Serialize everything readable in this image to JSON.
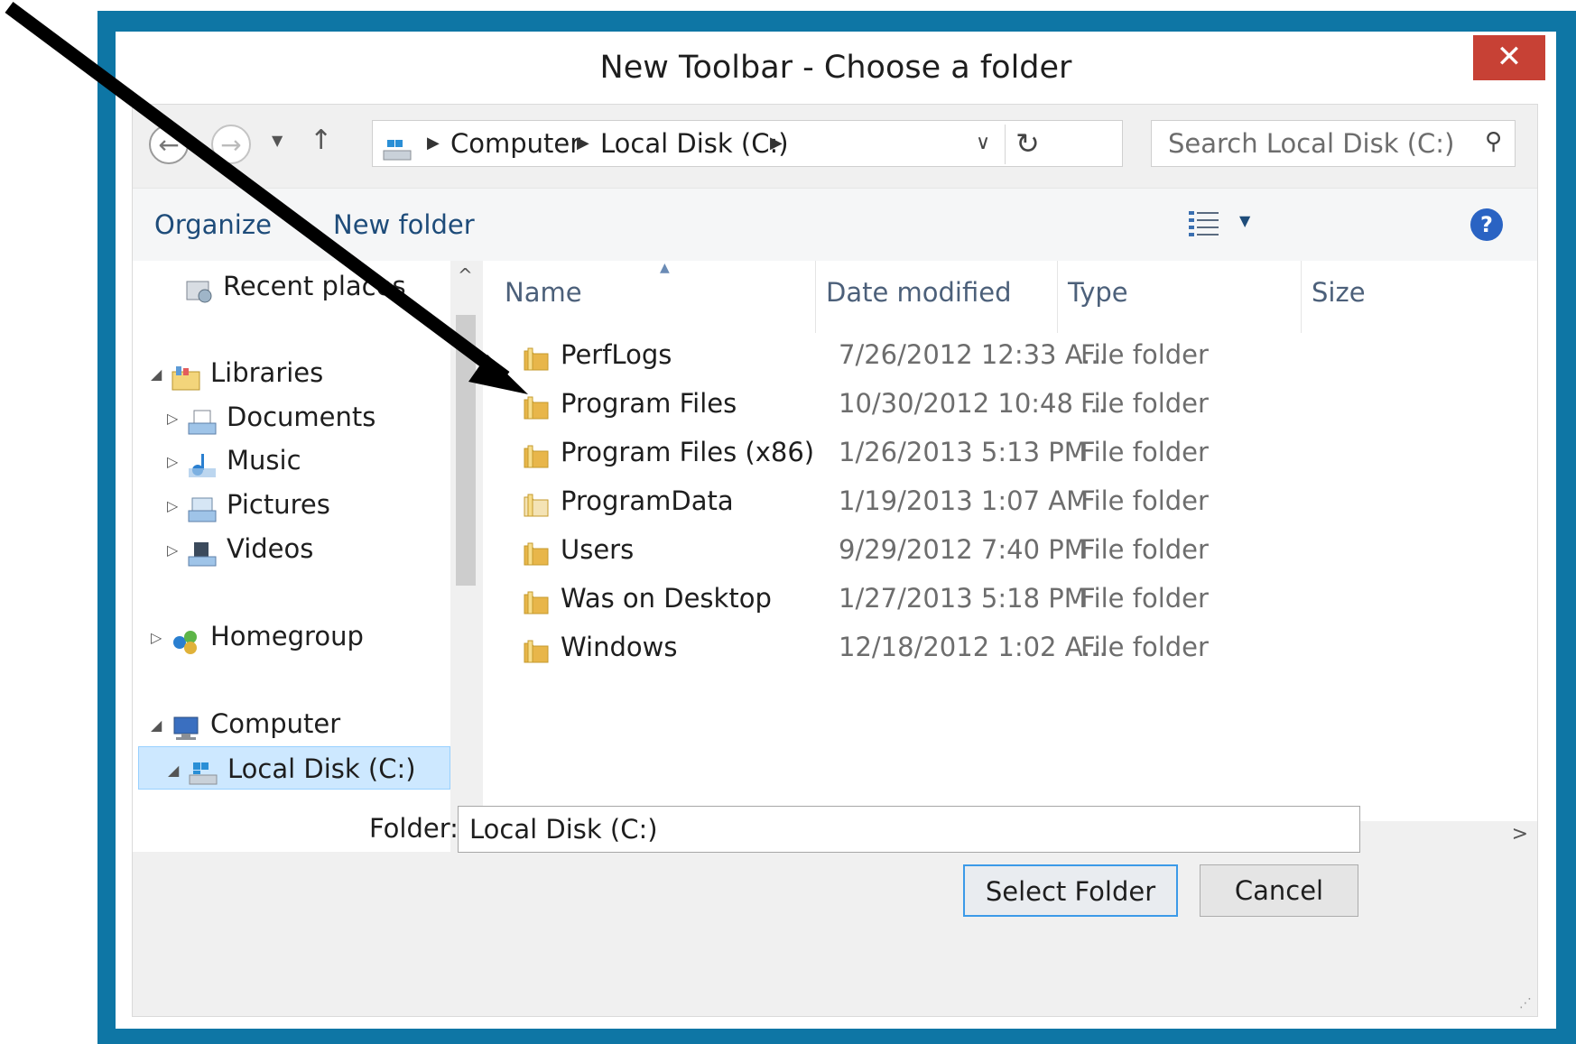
{
  "dialog": {
    "title": "New Toolbar - Choose a folder",
    "close_label": "✕"
  },
  "navbar": {
    "breadcrumb": [
      "Computer",
      "Local Disk (C:)"
    ],
    "search_placeholder": "Search Local Disk (C:)"
  },
  "commandbar": {
    "organize": "Organize",
    "new_folder": "New folder",
    "help": "?"
  },
  "tree": {
    "recent": "Recent places",
    "libraries": "Libraries",
    "documents": "Documents",
    "music": "Music",
    "pictures": "Pictures",
    "videos": "Videos",
    "homegroup": "Homegroup",
    "computer": "Computer",
    "local_disk": "Local Disk (C:)"
  },
  "columns": {
    "name": "Name",
    "date": "Date modified",
    "type": "Type",
    "size": "Size"
  },
  "files": [
    {
      "name": "PerfLogs",
      "date": "7/26/2012 12:33 A...",
      "type": "File folder"
    },
    {
      "name": "Program Files",
      "date": "10/30/2012 10:48 ...",
      "type": "File folder"
    },
    {
      "name": "Program Files (x86)",
      "date": "1/26/2013 5:13 PM",
      "type": "File folder"
    },
    {
      "name": "ProgramData",
      "date": "1/19/2013 1:07 AM",
      "type": "File folder"
    },
    {
      "name": "Users",
      "date": "9/29/2012 7:40 PM",
      "type": "File folder"
    },
    {
      "name": "Was on Desktop",
      "date": "1/27/2013 5:18 PM",
      "type": "File folder"
    },
    {
      "name": "Windows",
      "date": "12/18/2012 1:02 A...",
      "type": "File folder"
    }
  ],
  "footer": {
    "folder_label": "Folder:",
    "folder_value": "Local Disk (C:)",
    "select_button": "Select Folder",
    "cancel_button": "Cancel"
  },
  "colors": {
    "frame": "#0e76a5",
    "close": "#c74135",
    "selection": "#cde8ff"
  }
}
